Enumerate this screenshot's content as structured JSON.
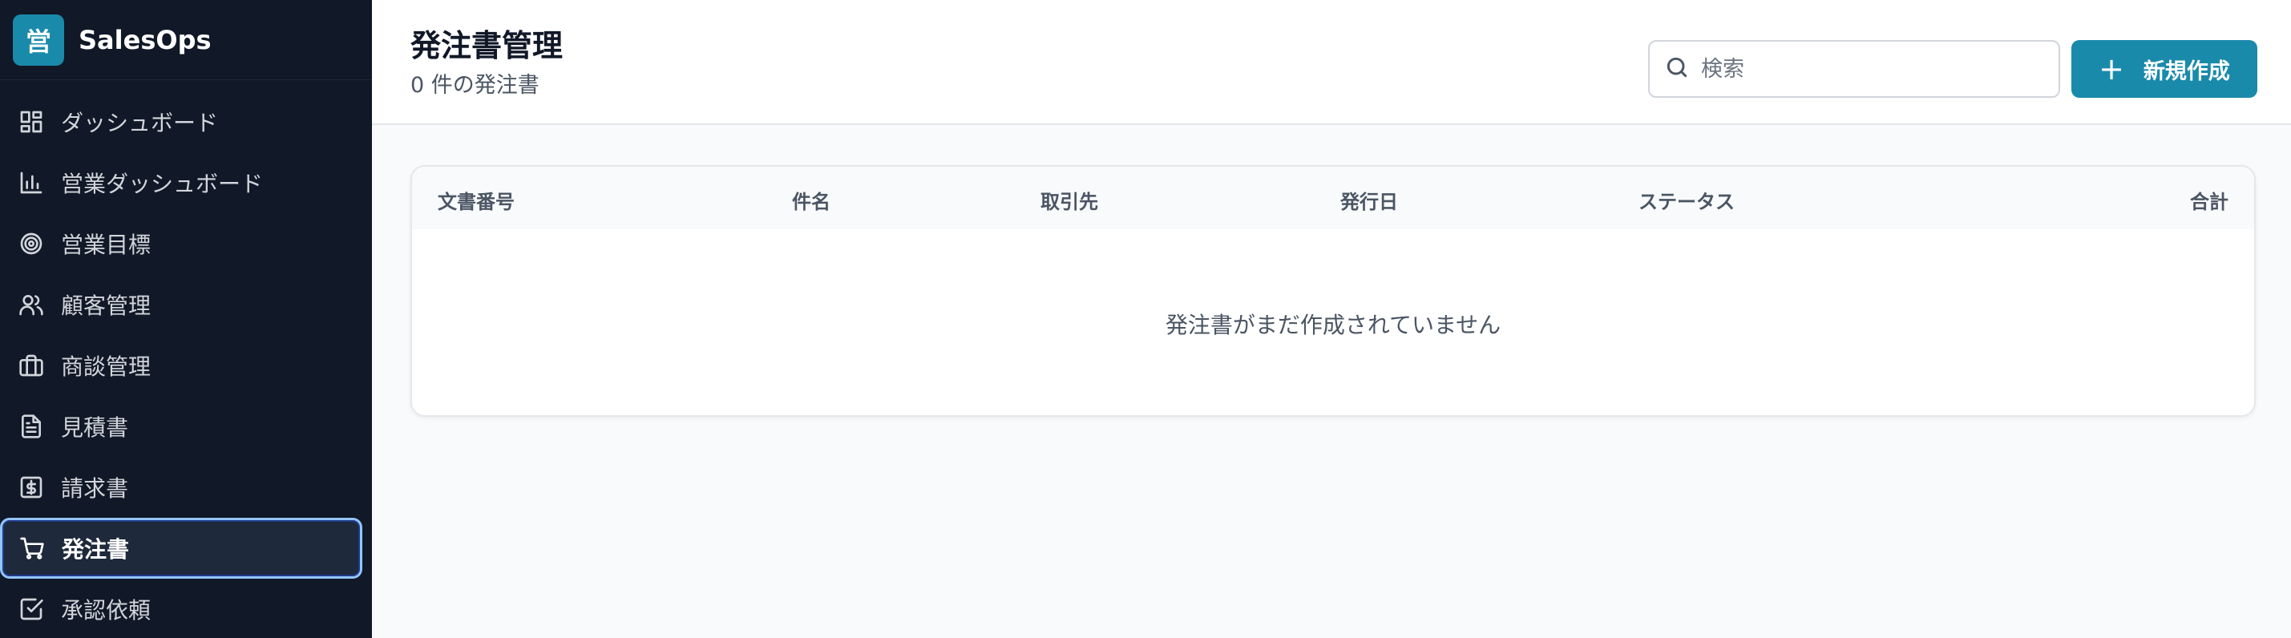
{
  "brand": {
    "logo_char": "営",
    "name": "SalesOps"
  },
  "sidebar": {
    "items": [
      {
        "label": "ダッシュボード",
        "icon": "dashboard-icon"
      },
      {
        "label": "営業ダッシュボード",
        "icon": "bar-chart-icon"
      },
      {
        "label": "営業目標",
        "icon": "target-icon"
      },
      {
        "label": "顧客管理",
        "icon": "users-icon"
      },
      {
        "label": "商談管理",
        "icon": "briefcase-icon"
      },
      {
        "label": "見積書",
        "icon": "document-icon"
      },
      {
        "label": "請求書",
        "icon": "invoice-icon"
      },
      {
        "label": "発注書",
        "icon": "cart-icon",
        "active": true
      },
      {
        "label": "承認依頼",
        "icon": "checkbox-icon"
      }
    ]
  },
  "header": {
    "title": "発注書管理",
    "subtitle": "0 件の発注書",
    "search_placeholder": "検索",
    "new_button_label": "新規作成"
  },
  "table": {
    "columns": [
      "文書番号",
      "件名",
      "取引先",
      "発行日",
      "ステータス",
      "合計"
    ],
    "rows": [],
    "empty_message": "発注書がまだ作成されていません"
  },
  "colors": {
    "sidebar_bg": "#111827",
    "accent": "#1a8aab",
    "active_border": "#93c5fd"
  }
}
